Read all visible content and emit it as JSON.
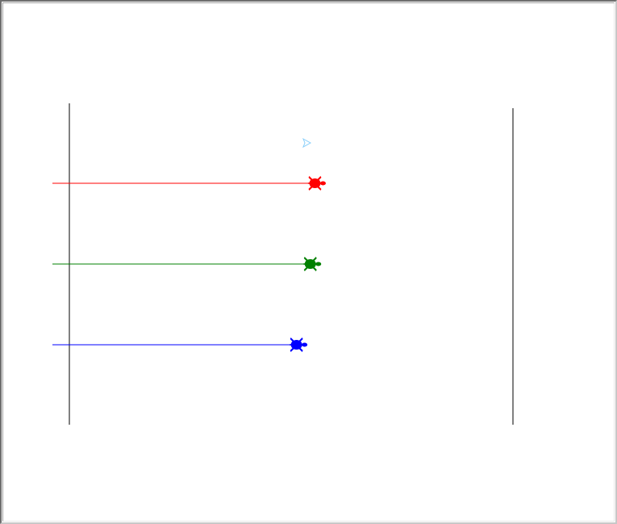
{
  "scene": {
    "background": "#ffffff",
    "boundary_color": "#000000",
    "pointer_color": "#87cefa",
    "turtles": [
      {
        "name": "red",
        "color": "#ff0000",
        "progress": 0.57
      },
      {
        "name": "green",
        "color": "#008000",
        "progress": 0.56
      },
      {
        "name": "blue",
        "color": "#0000ff",
        "progress": 0.53
      }
    ]
  }
}
